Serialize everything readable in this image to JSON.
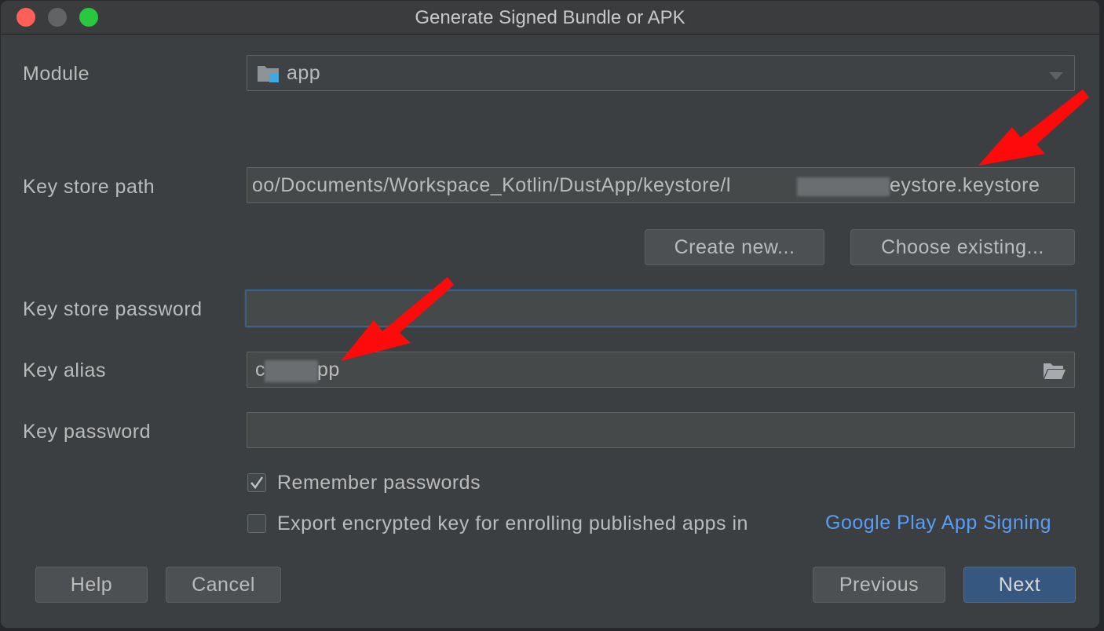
{
  "window": {
    "title": "Generate Signed Bundle or APK"
  },
  "module": {
    "label": "Module",
    "value": "app"
  },
  "key_store_path": {
    "label": "Key store path",
    "value_prefix": "oo/Documents/Workspace_Kotlin/DustApp/keystore/l",
    "value_suffix": "eystore.keystore"
  },
  "buttons": {
    "create_new": "Create new...",
    "choose_existing": "Choose existing...",
    "help": "Help",
    "cancel": "Cancel",
    "previous": "Previous",
    "next": "Next"
  },
  "key_store_password": {
    "label": "Key store password",
    "value": ""
  },
  "key_alias": {
    "label": "Key alias",
    "value_prefix": "c",
    "value_suffix": "pp"
  },
  "key_password": {
    "label": "Key password",
    "value": ""
  },
  "options": {
    "remember_passwords": {
      "label": "Remember passwords",
      "checked": true
    },
    "export_key": {
      "label": "Export encrypted key for enrolling published apps in",
      "link": "Google Play App Signing",
      "checked": false
    }
  },
  "icons": {
    "module_icon": "module-folder-icon",
    "dropdown": "chevron-down-icon",
    "folder": "folder-open-icon",
    "check": "checkmark-icon"
  },
  "colors": {
    "dialog_bg": "#3c3f41",
    "primary_button": "#365880",
    "link": "#589df6",
    "annotation_arrow": "#ff0000"
  }
}
